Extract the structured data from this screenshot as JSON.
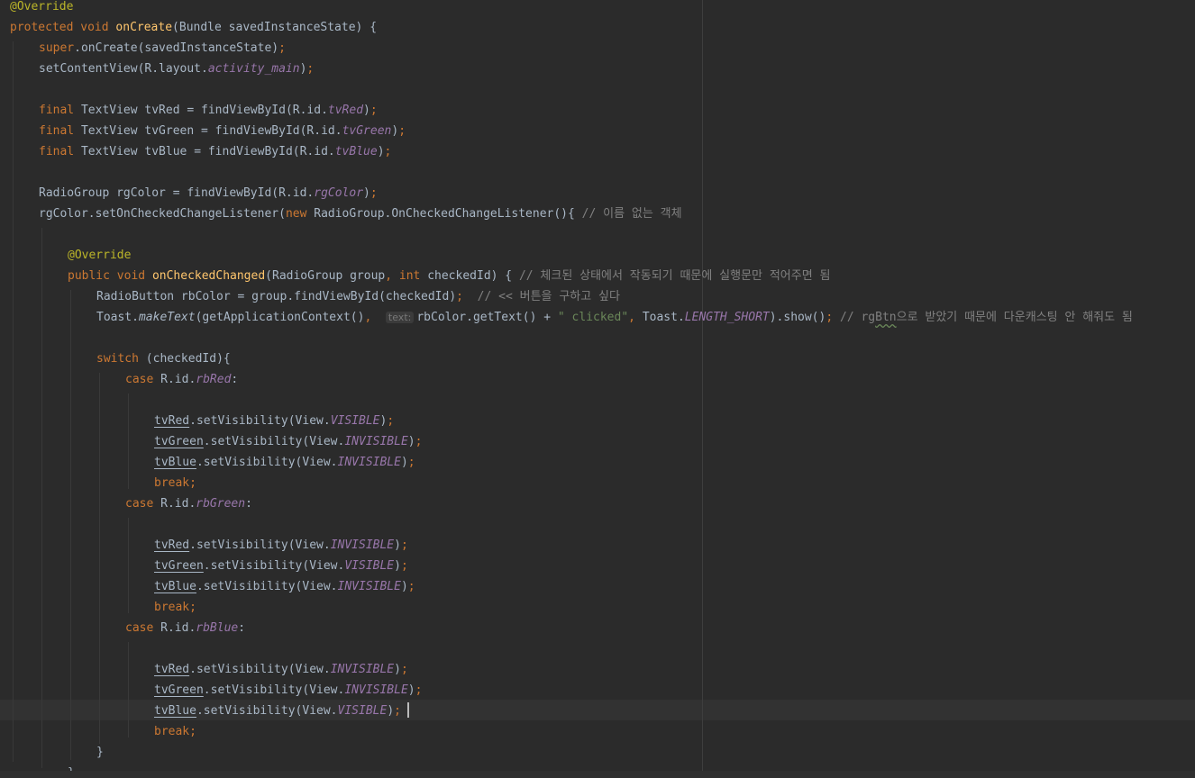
{
  "editor": {
    "lines": [
      {
        "indent": 0,
        "tokens": [
          {
            "k": "ann",
            "t": "@Override"
          }
        ]
      },
      {
        "indent": 0,
        "tokens": [
          {
            "k": "kw",
            "t": "protected "
          },
          {
            "k": "kw",
            "t": "void "
          },
          {
            "k": "fn",
            "t": "onCreate"
          },
          {
            "k": "p",
            "t": "(Bundle savedInstanceState) {"
          }
        ]
      },
      {
        "indent": 1,
        "tokens": [
          {
            "k": "kw",
            "t": "super"
          },
          {
            "k": "p",
            "t": ".onCreate(savedInstanceState)"
          },
          {
            "k": "kw",
            "t": ";"
          }
        ]
      },
      {
        "indent": 1,
        "tokens": [
          {
            "k": "p",
            "t": "setContentView(R.layout."
          },
          {
            "k": "fld",
            "t": "activity_main"
          },
          {
            "k": "p",
            "t": ")"
          },
          {
            "k": "kw",
            "t": ";"
          }
        ]
      },
      {
        "indent": 0,
        "tokens": []
      },
      {
        "indent": 1,
        "tokens": [
          {
            "k": "kw",
            "t": "final "
          },
          {
            "k": "p",
            "t": "TextView tvRed = findViewById(R.id."
          },
          {
            "k": "fld",
            "t": "tvRed"
          },
          {
            "k": "p",
            "t": ")"
          },
          {
            "k": "kw",
            "t": ";"
          }
        ]
      },
      {
        "indent": 1,
        "tokens": [
          {
            "k": "kw",
            "t": "final "
          },
          {
            "k": "p",
            "t": "TextView tvGreen = findViewById(R.id."
          },
          {
            "k": "fld",
            "t": "tvGreen"
          },
          {
            "k": "p",
            "t": ")"
          },
          {
            "k": "kw",
            "t": ";"
          }
        ]
      },
      {
        "indent": 1,
        "tokens": [
          {
            "k": "kw",
            "t": "final "
          },
          {
            "k": "p",
            "t": "TextView tvBlue = findViewById(R.id."
          },
          {
            "k": "fld",
            "t": "tvBlue"
          },
          {
            "k": "p",
            "t": ")"
          },
          {
            "k": "kw",
            "t": ";"
          }
        ]
      },
      {
        "indent": 0,
        "tokens": []
      },
      {
        "indent": 1,
        "tokens": [
          {
            "k": "p",
            "t": "RadioGroup rgColor = findViewById(R.id."
          },
          {
            "k": "fld",
            "t": "rgColor"
          },
          {
            "k": "p",
            "t": ")"
          },
          {
            "k": "kw",
            "t": ";"
          }
        ]
      },
      {
        "indent": 1,
        "tokens": [
          {
            "k": "p",
            "t": "rgColor.setOnCheckedChangeListener("
          },
          {
            "k": "kw",
            "t": "new "
          },
          {
            "k": "p",
            "t": "RadioGroup.OnCheckedChangeListener(){ "
          },
          {
            "k": "com",
            "t": "// 이름 없는 객체"
          }
        ]
      },
      {
        "indent": 0,
        "tokens": []
      },
      {
        "indent": 2,
        "tokens": [
          {
            "k": "ann",
            "t": "@Override"
          }
        ]
      },
      {
        "indent": 2,
        "tokens": [
          {
            "k": "kw",
            "t": "public "
          },
          {
            "k": "kw",
            "t": "void "
          },
          {
            "k": "fn",
            "t": "onCheckedChanged"
          },
          {
            "k": "p",
            "t": "(RadioGroup group"
          },
          {
            "k": "kw",
            "t": ", int "
          },
          {
            "k": "p",
            "t": "checkedId) { "
          },
          {
            "k": "com",
            "t": "// 체크된 상태에서 작동되기 때문에 실행문만 적어주면 됨"
          }
        ]
      },
      {
        "indent": 3,
        "tokens": [
          {
            "k": "p",
            "t": "RadioButton rbColor = group.findViewById(checkedId)"
          },
          {
            "k": "kw",
            "t": ";  "
          },
          {
            "k": "com",
            "t": "// << 버튼을 구하고 싶다"
          }
        ]
      },
      {
        "indent": 3,
        "tokens": [
          {
            "k": "p",
            "t": "Toast."
          },
          {
            "k": "st",
            "t": "makeText"
          },
          {
            "k": "p",
            "t": "(getApplicationContext()"
          },
          {
            "k": "kw",
            "t": ",  "
          },
          {
            "k": "hint",
            "t": "text:"
          },
          {
            "k": "p",
            "t": "rbColor.getText() + "
          },
          {
            "k": "str",
            "t": "\" clicked\""
          },
          {
            "k": "kw",
            "t": ", "
          },
          {
            "k": "p",
            "t": "Toast."
          },
          {
            "k": "fld",
            "t": "LENGTH_SHORT"
          },
          {
            "k": "p",
            "t": ").show()"
          },
          {
            "k": "kw",
            "t": "; "
          },
          {
            "k": "com",
            "t": "// rg"
          },
          {
            "k": "comw",
            "t": "Btn"
          },
          {
            "k": "com",
            "t": "으로 받았기 때문에 다운캐스팅 안 해줘도 됨"
          }
        ]
      },
      {
        "indent": 0,
        "tokens": []
      },
      {
        "indent": 3,
        "tokens": [
          {
            "k": "kw",
            "t": "switch "
          },
          {
            "k": "p",
            "t": "(checkedId){"
          }
        ]
      },
      {
        "indent": 4,
        "tokens": [
          {
            "k": "kw",
            "t": "case "
          },
          {
            "k": "p",
            "t": "R.id."
          },
          {
            "k": "fld",
            "t": "rbRed"
          },
          {
            "k": "p",
            "t": ":"
          }
        ]
      },
      {
        "indent": 0,
        "tokens": []
      },
      {
        "indent": 5,
        "tokens": [
          {
            "k": "loc",
            "t": "tvRed"
          },
          {
            "k": "p",
            "t": ".setVisibility(View."
          },
          {
            "k": "fld",
            "t": "VISIBLE"
          },
          {
            "k": "p",
            "t": ")"
          },
          {
            "k": "kw",
            "t": ";"
          }
        ]
      },
      {
        "indent": 5,
        "tokens": [
          {
            "k": "loc",
            "t": "tvGreen"
          },
          {
            "k": "p",
            "t": ".setVisibility(View."
          },
          {
            "k": "fld",
            "t": "INVISIBLE"
          },
          {
            "k": "p",
            "t": ")"
          },
          {
            "k": "kw",
            "t": ";"
          }
        ]
      },
      {
        "indent": 5,
        "tokens": [
          {
            "k": "loc",
            "t": "tvBlue"
          },
          {
            "k": "p",
            "t": ".setVisibility(View."
          },
          {
            "k": "fld",
            "t": "INVISIBLE"
          },
          {
            "k": "p",
            "t": ")"
          },
          {
            "k": "kw",
            "t": ";"
          }
        ]
      },
      {
        "indent": 5,
        "tokens": [
          {
            "k": "kw",
            "t": "break;"
          }
        ]
      },
      {
        "indent": 4,
        "tokens": [
          {
            "k": "kw",
            "t": "case "
          },
          {
            "k": "p",
            "t": "R.id."
          },
          {
            "k": "fld",
            "t": "rbGreen"
          },
          {
            "k": "p",
            "t": ":"
          }
        ]
      },
      {
        "indent": 0,
        "tokens": []
      },
      {
        "indent": 5,
        "tokens": [
          {
            "k": "loc",
            "t": "tvRed"
          },
          {
            "k": "p",
            "t": ".setVisibility(View."
          },
          {
            "k": "fld",
            "t": "INVISIBLE"
          },
          {
            "k": "p",
            "t": ")"
          },
          {
            "k": "kw",
            "t": ";"
          }
        ]
      },
      {
        "indent": 5,
        "tokens": [
          {
            "k": "loc",
            "t": "tvGreen"
          },
          {
            "k": "p",
            "t": ".setVisibility(View."
          },
          {
            "k": "fld",
            "t": "VISIBLE"
          },
          {
            "k": "p",
            "t": ")"
          },
          {
            "k": "kw",
            "t": ";"
          }
        ]
      },
      {
        "indent": 5,
        "tokens": [
          {
            "k": "loc",
            "t": "tvBlue"
          },
          {
            "k": "p",
            "t": ".setVisibility(View."
          },
          {
            "k": "fld",
            "t": "INVISIBLE"
          },
          {
            "k": "p",
            "t": ")"
          },
          {
            "k": "kw",
            "t": ";"
          }
        ]
      },
      {
        "indent": 5,
        "tokens": [
          {
            "k": "kw",
            "t": "break;"
          }
        ]
      },
      {
        "indent": 4,
        "tokens": [
          {
            "k": "kw",
            "t": "case "
          },
          {
            "k": "p",
            "t": "R.id."
          },
          {
            "k": "fld",
            "t": "rbBlue"
          },
          {
            "k": "p",
            "t": ":"
          }
        ]
      },
      {
        "indent": 0,
        "tokens": []
      },
      {
        "indent": 5,
        "tokens": [
          {
            "k": "loc",
            "t": "tvRed"
          },
          {
            "k": "p",
            "t": ".setVisibility(View."
          },
          {
            "k": "fld",
            "t": "INVISIBLE"
          },
          {
            "k": "p",
            "t": ")"
          },
          {
            "k": "kw",
            "t": ";"
          }
        ]
      },
      {
        "indent": 5,
        "tokens": [
          {
            "k": "loc",
            "t": "tvGreen"
          },
          {
            "k": "p",
            "t": ".setVisibility(View."
          },
          {
            "k": "fld",
            "t": "INVISIBLE"
          },
          {
            "k": "p",
            "t": ")"
          },
          {
            "k": "kw",
            "t": ";"
          }
        ]
      },
      {
        "indent": 5,
        "tokens": [
          {
            "k": "loc",
            "t": "tvBlue"
          },
          {
            "k": "p",
            "t": ".setVisibility(View."
          },
          {
            "k": "fld",
            "t": "VISIBLE"
          },
          {
            "k": "p",
            "t": ")"
          },
          {
            "k": "kw",
            "t": ";"
          }
        ]
      },
      {
        "indent": 5,
        "tokens": [
          {
            "k": "kw",
            "t": "break;"
          }
        ]
      },
      {
        "indent": 3,
        "tokens": [
          {
            "k": "p",
            "t": "}"
          }
        ]
      },
      {
        "indent": 2,
        "tokens": [
          {
            "k": "p",
            "t": "}"
          }
        ]
      }
    ]
  },
  "colors": {
    "background": "#2b2b2b",
    "current_line": "#323232",
    "keyword": "#cc7832",
    "annotation": "#bbb529",
    "method": "#ffc66d",
    "field": "#9876aa",
    "string": "#6a8759",
    "comment": "#808080",
    "plain": "#a9b7c6"
  }
}
